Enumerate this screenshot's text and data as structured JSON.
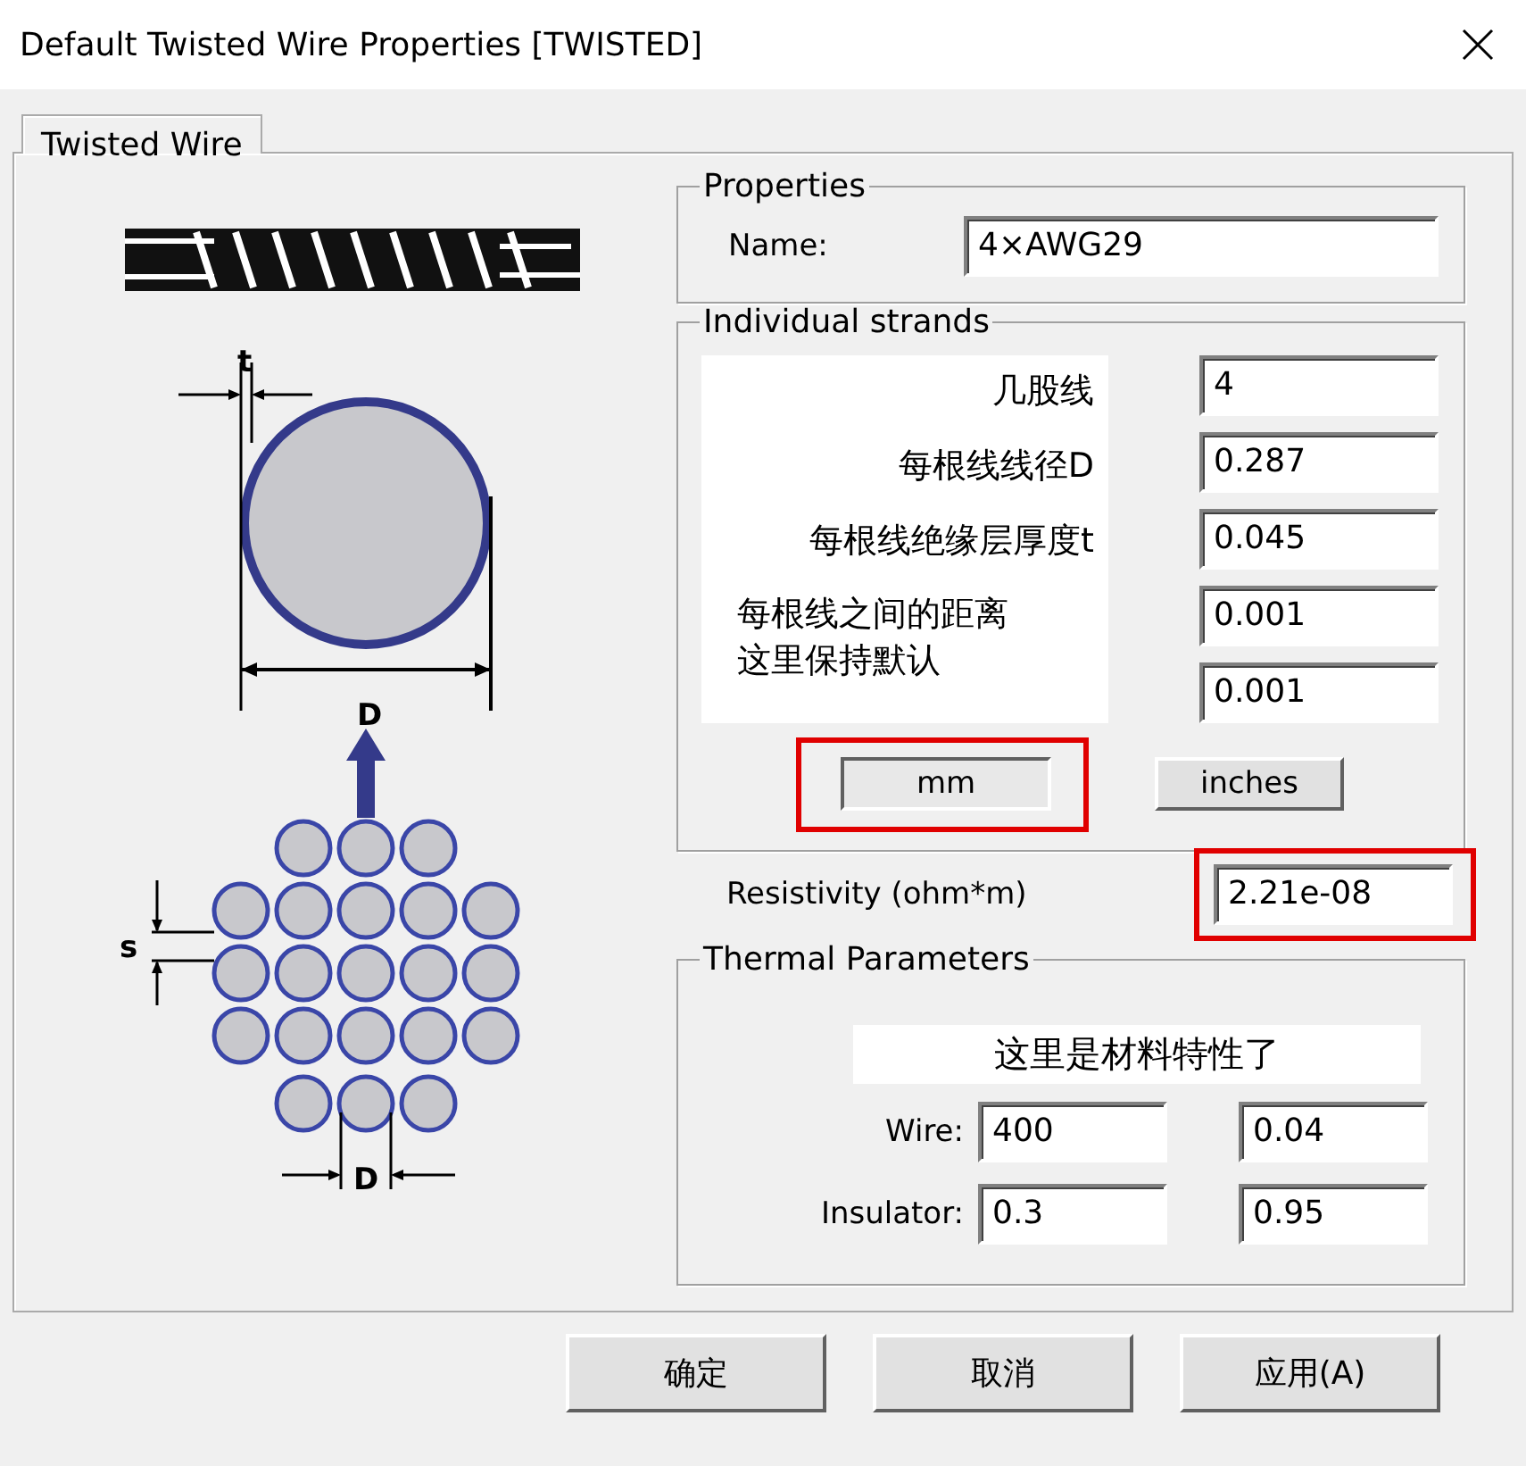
{
  "window": {
    "title": "Default Twisted Wire Properties [TWISTED]"
  },
  "tabs": [
    {
      "label": "Twisted Wire",
      "selected": true
    }
  ],
  "diagram": {
    "labels": [
      "t",
      "D",
      "s",
      "D"
    ]
  },
  "properties": {
    "title": "Properties",
    "name_label": "Name:",
    "name_value": "4×AWG29"
  },
  "strands": {
    "title": "Individual strands",
    "notes": [
      {
        "text": "几股线",
        "kind": "single"
      },
      {
        "text": "每根线线径D",
        "kind": "single"
      },
      {
        "text": "每根线绝缘层厚度t",
        "kind": "single"
      },
      {
        "text": "每根线之间的距离",
        "kind": "left"
      },
      {
        "text": "这里保持默认",
        "kind": "left"
      }
    ],
    "values": [
      "4",
      "0.287",
      "0.045",
      "0.001",
      "0.001"
    ],
    "units": [
      {
        "label": "mm",
        "selected": true
      },
      {
        "label": "inches",
        "selected": false
      }
    ]
  },
  "resistivity": {
    "label": "Resistivity (ohm*m)",
    "value": "2.21e-08"
  },
  "thermal": {
    "title": "Thermal Parameters",
    "note": "这里是材料特性了",
    "rows": [
      {
        "label": "Wire:",
        "values": [
          "400",
          "0.04"
        ]
      },
      {
        "label": "Insulator:",
        "values": [
          "0.3",
          "0.95"
        ]
      }
    ]
  },
  "buttons": [
    "确定",
    "取消",
    "应用(A)"
  ]
}
